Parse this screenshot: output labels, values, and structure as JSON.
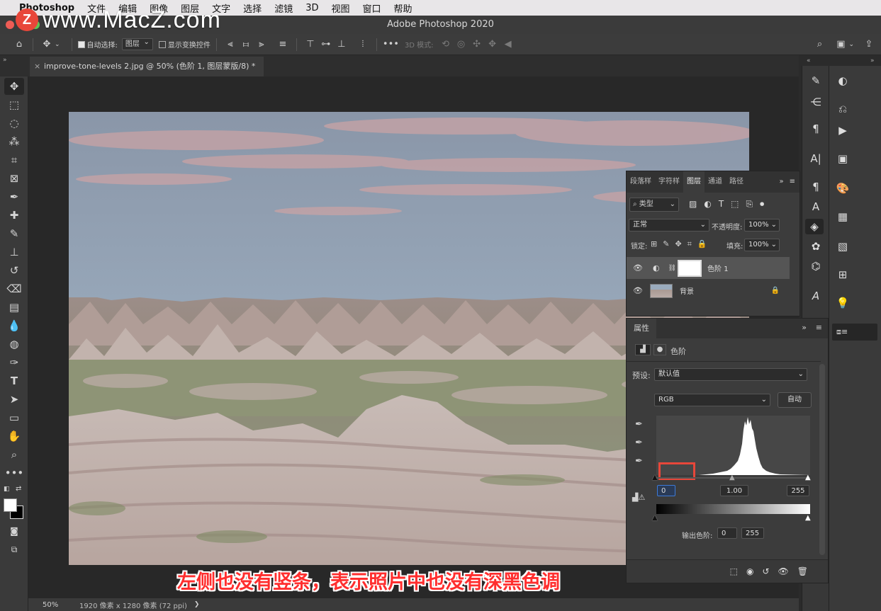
{
  "menubar": {
    "app": "Photoshop",
    "items": [
      "文件",
      "编辑",
      "图像",
      "图层",
      "文字",
      "选择",
      "滤镜",
      "3D",
      "视图",
      "窗口",
      "帮助"
    ]
  },
  "window": {
    "title": "Adobe Photoshop 2020"
  },
  "watermark": {
    "logo": "Z",
    "text": "www.MacZ.com"
  },
  "options": {
    "auto_select_label": "自动选择:",
    "auto_select_value": "图层",
    "show_transform_label": "显示变换控件",
    "mode3d_label": "3D 模式:"
  },
  "document": {
    "tab_close": "×",
    "tab_title": "improve-tone-levels 2.jpg @ 50% (色阶 1, 图层蒙版/8) *"
  },
  "status": {
    "zoom": "50%",
    "info": "1920 像素 x 1280 像素 (72 ppi)",
    "arrow": "❯"
  },
  "layers_panel": {
    "tabs": [
      "段落样",
      "字符样",
      "图层",
      "通道",
      "路径"
    ],
    "active_tab": "图层",
    "filter_label": "类型",
    "blend_mode": "正常",
    "opacity_label": "不透明度:",
    "opacity_value": "100%",
    "lock_label": "锁定:",
    "fill_label": "填充:",
    "fill_value": "100%",
    "layers": [
      {
        "name": "色阶 1",
        "selected": true
      },
      {
        "name": "背景",
        "selected": false
      }
    ]
  },
  "properties_panel": {
    "title": "属性",
    "adjustment_label": "色阶",
    "preset_label": "预设:",
    "preset_value": "默认值",
    "channel_value": "RGB",
    "auto_button": "自动",
    "input_black": "0",
    "input_gamma": "1.00",
    "input_white": "255",
    "output_label": "输出色阶:",
    "output_black": "0",
    "output_white": "255"
  },
  "caption": {
    "text": "左侧也没有竖条，表示照片中也没有深黑色调"
  },
  "colors": {
    "highlight_box": "#e8473a",
    "caption": "#ff2e2e",
    "panel_bg": "#3c3c3c"
  }
}
